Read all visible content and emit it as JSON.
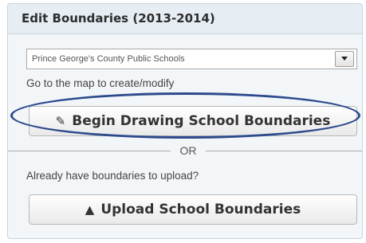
{
  "panel": {
    "title": "Edit Boundaries (2013-2014)"
  },
  "district_select": {
    "selected": "Prince George's County Public Schools",
    "arrow_icon": "triangle-down"
  },
  "map_hint": "Go to the map to create/modify",
  "draw_button": {
    "icon": "✎",
    "icon_name": "pencil-icon",
    "label": "Begin Drawing School Boundaries"
  },
  "divider": {
    "label": "OR"
  },
  "upload_prompt": "Already have boundaries to upload?",
  "upload_button": {
    "icon": "▲",
    "icon_name": "upload-arrow-icon",
    "label": "Upload School Boundaries"
  },
  "highlight_color": "#2d4a8c"
}
